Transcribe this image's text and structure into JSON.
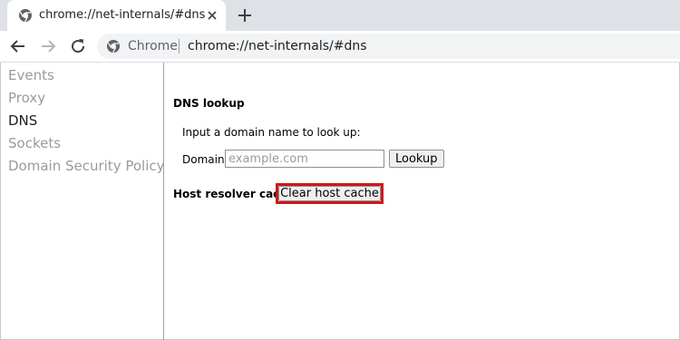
{
  "tab": {
    "title": "chrome://net-internals/#dns"
  },
  "omnibox": {
    "site_name": "Chrome",
    "url": "chrome://net-internals/#dns"
  },
  "sidebar": {
    "items": [
      {
        "label": "Events",
        "active": false
      },
      {
        "label": "Proxy",
        "active": false
      },
      {
        "label": "DNS",
        "active": true
      },
      {
        "label": "Sockets",
        "active": false
      },
      {
        "label": "Domain Security Policy",
        "active": false
      }
    ]
  },
  "dns": {
    "title": "DNS lookup",
    "hint": "Input a domain name to look up:",
    "domain_label": "Domain:",
    "domain_placeholder": "example.com",
    "lookup_label": "Lookup",
    "host_cache_title": "Host resolver cache",
    "clear_label": "Clear host cache"
  },
  "colors": {
    "highlight": "#cc1a1a",
    "tabstrip": "#dee1e6",
    "omnibox": "#f1f3f4"
  },
  "icons": [
    "chrome-page-icon",
    "close-icon",
    "plus-icon",
    "back-arrow-icon",
    "forward-arrow-icon",
    "reload-icon",
    "chrome-logo-icon"
  ]
}
